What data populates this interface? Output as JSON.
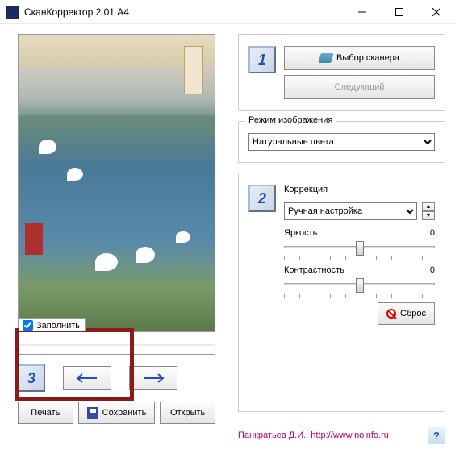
{
  "window": {
    "title": "СканКорректор 2.01 A4"
  },
  "preview": {
    "fill_label": "Заполнить",
    "fill_checked": true
  },
  "nav": {
    "step_number": "3"
  },
  "actions": {
    "print": "Печать",
    "save": "Сохранить",
    "open": "Открыть"
  },
  "scanner": {
    "select": "Выбор сканера",
    "next": "Следующий"
  },
  "image_mode": {
    "legend": "Режим изображения",
    "selected": "Натуральные цвета"
  },
  "correction": {
    "step_number": "2",
    "legend": "Коррекция",
    "preset": "Ручная настройка",
    "brightness_label": "Яркость",
    "brightness_value": "0",
    "contrast_label": "Контрастность",
    "contrast_value": "0",
    "reset": "Сброс"
  },
  "footer": {
    "credit": "Панкратьев Д.И., http://www.noinfo.ru",
    "help": "?"
  },
  "step1": "1"
}
